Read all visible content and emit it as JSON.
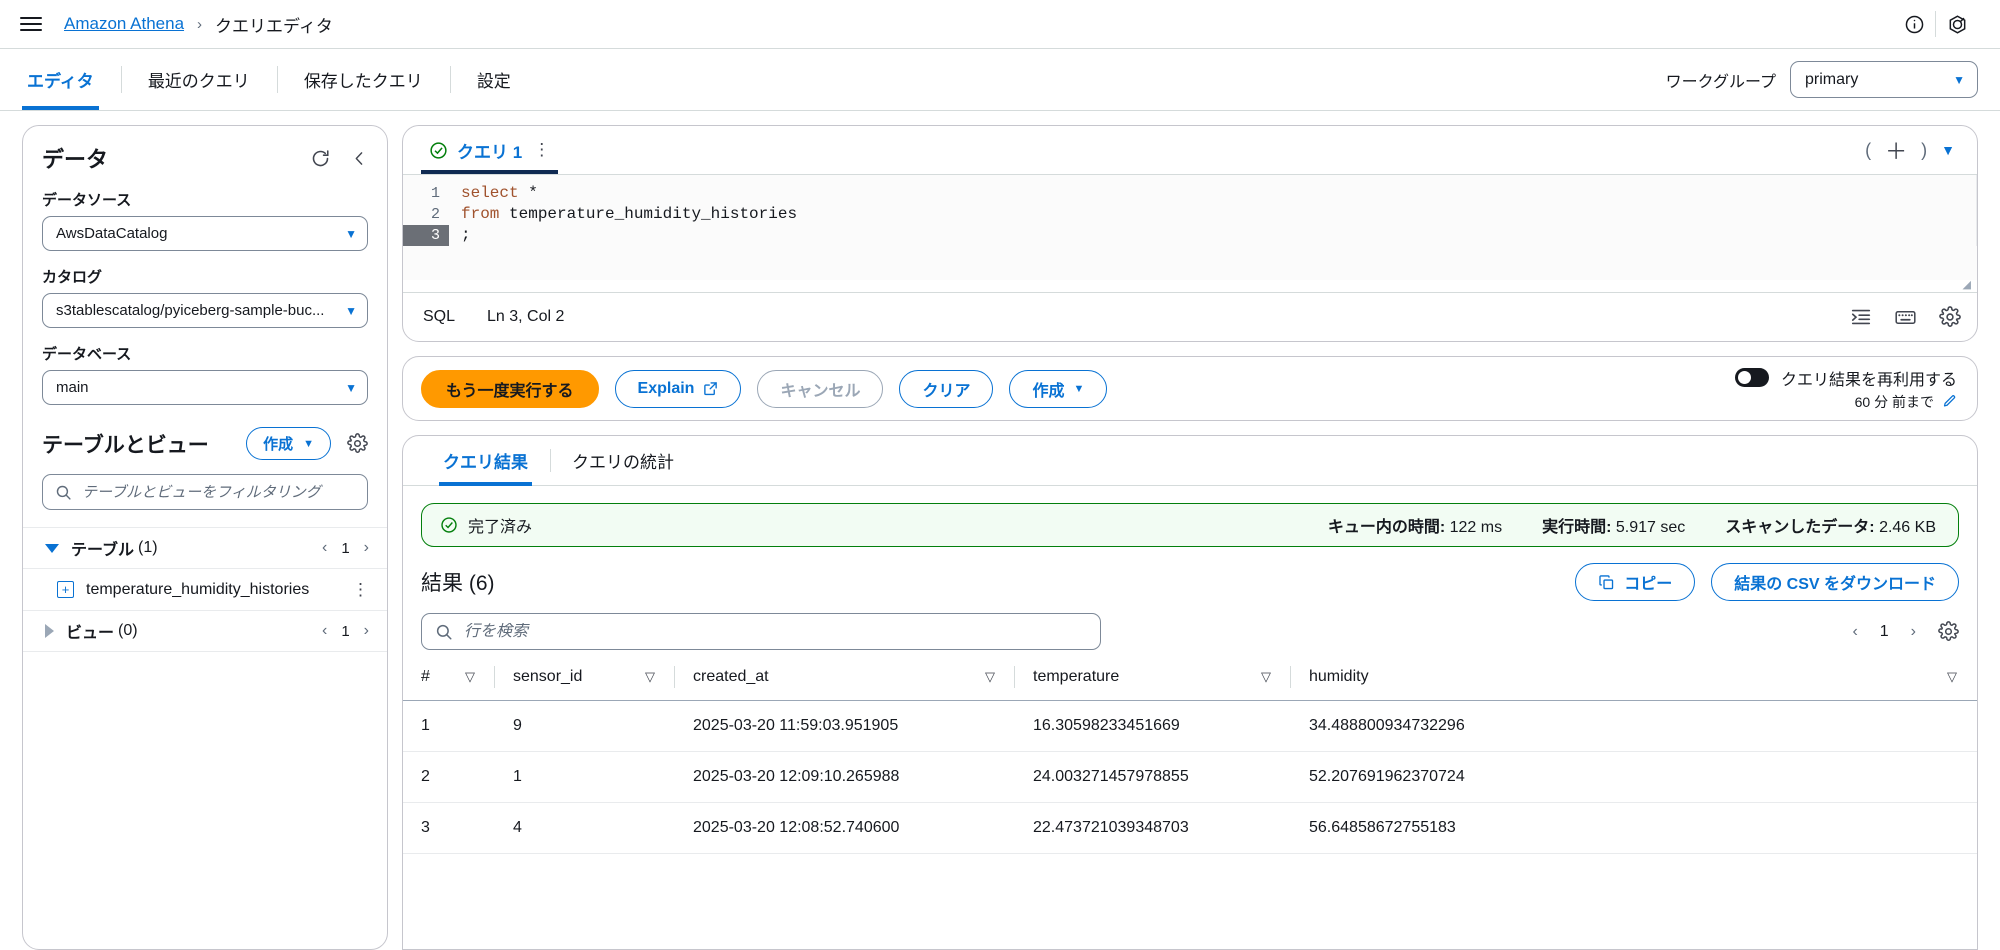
{
  "header": {
    "menu_icon": "hamburger-icon",
    "breadcrumb_root": "Amazon Athena",
    "breadcrumb_sep": "›",
    "breadcrumb_current": "クエリエディタ",
    "info_icon": "info-icon",
    "settings_icon": "region-icon"
  },
  "nav": {
    "tabs": [
      {
        "label": "エディタ",
        "active": true
      },
      {
        "label": "最近のクエリ",
        "active": false
      },
      {
        "label": "保存したクエリ",
        "active": false
      },
      {
        "label": "設定",
        "active": false
      }
    ],
    "workgroup_label": "ワークグループ",
    "workgroup_value": "primary"
  },
  "sidebar": {
    "title": "データ",
    "refresh_icon": "refresh-icon",
    "collapse_icon": "chevron-left-icon",
    "datasource_label": "データソース",
    "datasource_value": "AwsDataCatalog",
    "catalog_label": "カタログ",
    "catalog_value": "s3tablescatalog/pyiceberg-sample-buc...",
    "database_label": "データベース",
    "database_value": "main",
    "tables_title": "テーブルとビュー",
    "create_button": "作成",
    "gear_icon": "gear-icon",
    "filter_placeholder": "テーブルとビューをフィルタリング",
    "groups": [
      {
        "name": "テーブル",
        "count": "(1)",
        "expanded": true,
        "page": "1"
      },
      {
        "name": "ビュー",
        "count": "(0)",
        "expanded": false,
        "page": "1"
      }
    ],
    "table_items": [
      {
        "name": "temperature_humidity_histories"
      }
    ]
  },
  "editor": {
    "tab_label": "クエリ 1",
    "tab_status_icon": "success-check-icon",
    "tab_menu_icon": "more-options-icon",
    "paren_left": "(",
    "paren_right": ")",
    "add_icon": "plus-icon",
    "caret_icon": "chevron-down-icon",
    "code_lines": [
      {
        "num": "1",
        "text": "select *",
        "current": false
      },
      {
        "num": "2",
        "text": "from temperature_humidity_histories",
        "current": false
      },
      {
        "num": "3",
        "text": ";",
        "current": true
      }
    ],
    "status_language": "SQL",
    "status_position": "Ln 3, Col 2",
    "format_icon": "format-icon",
    "keyboard_icon": "keyboard-icon",
    "settings_icon": "gear-icon"
  },
  "actions": {
    "run_label": "もう一度実行する",
    "explain_label": "Explain",
    "explain_external_icon": "external-link-icon",
    "cancel_label": "キャンセル",
    "clear_label": "クリア",
    "create_label": "作成",
    "reuse_label": "クエリ結果を再利用する",
    "reuse_sub": "60 分 前まで",
    "reuse_edit_icon": "pencil-icon",
    "toggle_on": true
  },
  "results": {
    "tabs": [
      {
        "label": "クエリ結果",
        "active": true
      },
      {
        "label": "クエリの統計",
        "active": false
      }
    ],
    "status_icon": "success-check-icon",
    "status_text": "完了済み",
    "metrics": [
      {
        "label": "キュー内の時間:",
        "value": "122 ms"
      },
      {
        "label": "実行時間:",
        "value": "5.917 sec"
      },
      {
        "label": "スキャンしたデータ:",
        "value": "2.46 KB"
      }
    ],
    "title": "結果",
    "count": "(6)",
    "copy_label": "コピー",
    "copy_icon": "copy-icon",
    "download_label": "結果の CSV をダウンロード",
    "search_placeholder": "行を検索",
    "search_icon": "search-icon",
    "page_number": "1",
    "prev_icon": "chevron-left-icon",
    "next_icon": "chevron-right-icon",
    "gear_icon": "gear-icon",
    "columns": [
      "#",
      "sensor_id",
      "created_at",
      "temperature",
      "humidity"
    ],
    "rows": [
      {
        "n": "1",
        "sensor_id": "9",
        "created_at": "2025-03-20 11:59:03.951905",
        "temperature": "16.30598233451669",
        "humidity": "34.488800934732296"
      },
      {
        "n": "2",
        "sensor_id": "1",
        "created_at": "2025-03-20 12:09:10.265988",
        "temperature": "24.003271457978855",
        "humidity": "52.207691962370724"
      },
      {
        "n": "3",
        "sensor_id": "4",
        "created_at": "2025-03-20 12:08:52.740600",
        "temperature": "22.473721039348703",
        "humidity": "56.64858672755183"
      }
    ]
  },
  "colors": {
    "accent": "#0972d3",
    "primary_button": "#ff9900",
    "success": "#037f0c",
    "success_bg": "#f2fcf3"
  }
}
